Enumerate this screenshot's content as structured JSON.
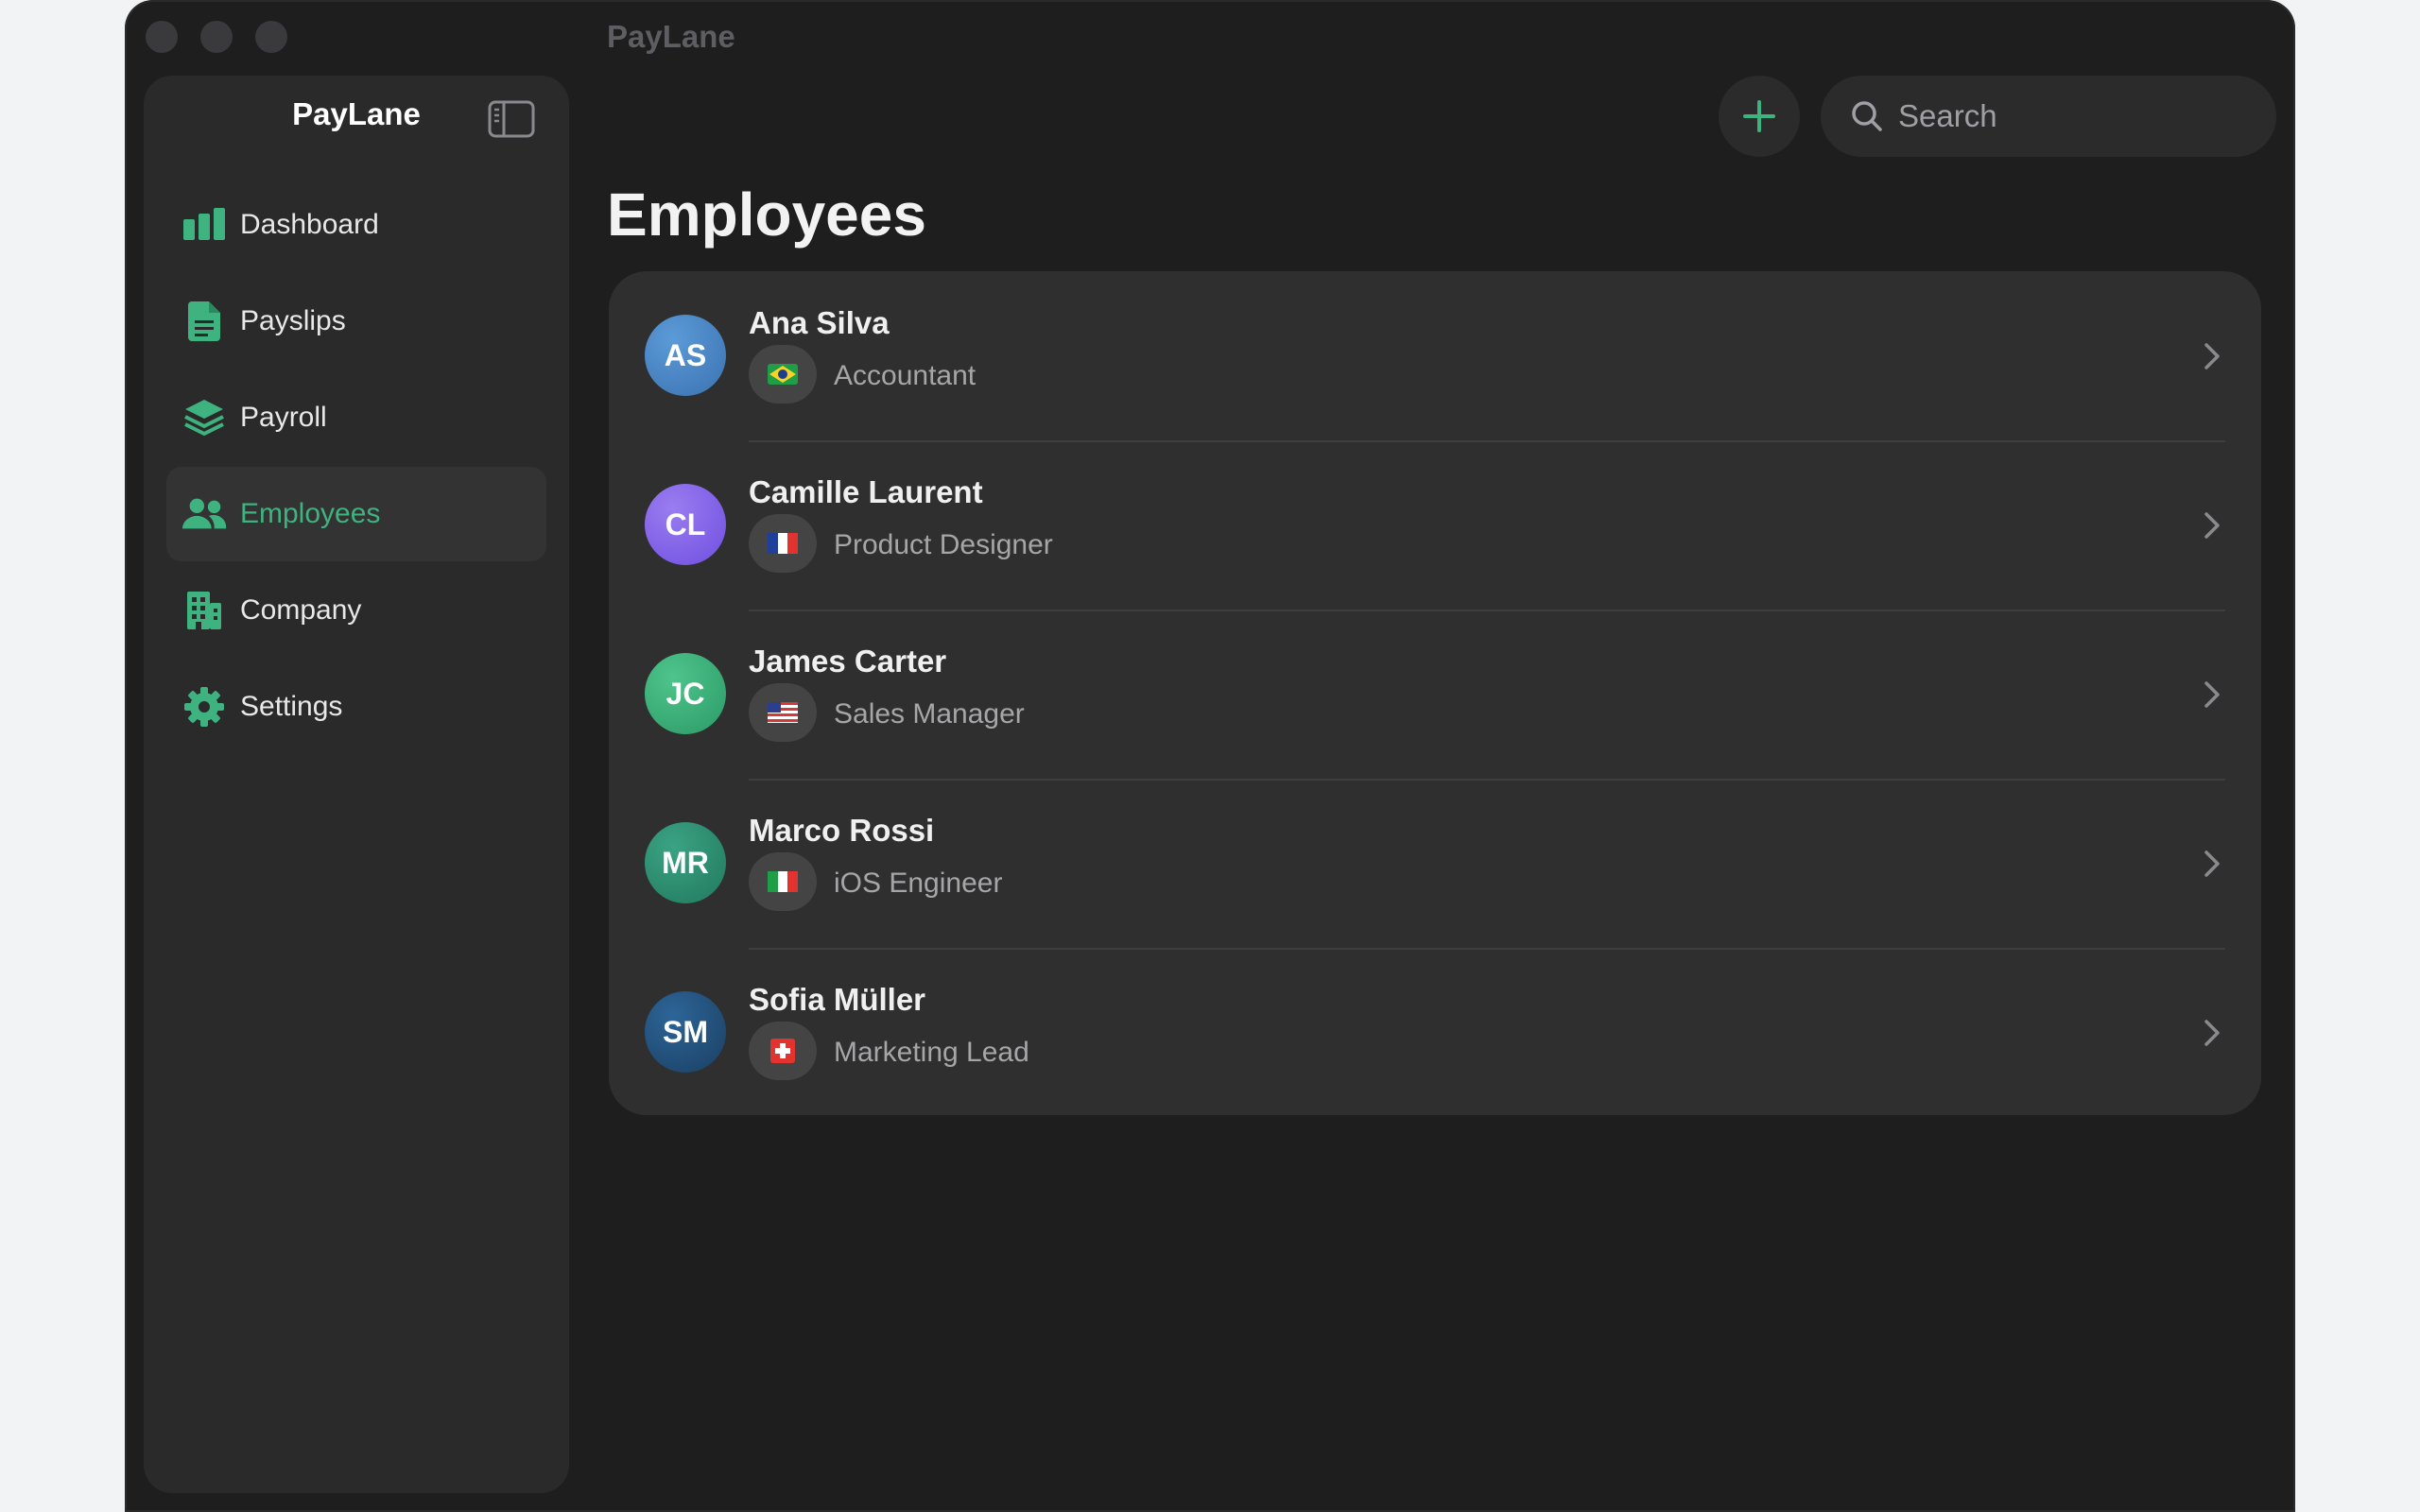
{
  "window": {
    "title": "PayLane"
  },
  "sidebar": {
    "app_name": "PayLane",
    "items": [
      {
        "label": "Dashboard",
        "icon": "bar-chart-icon",
        "active": false
      },
      {
        "label": "Payslips",
        "icon": "document-icon",
        "active": false
      },
      {
        "label": "Payroll",
        "icon": "layers-icon",
        "active": false
      },
      {
        "label": "Employees",
        "icon": "people-icon",
        "active": true
      },
      {
        "label": "Company",
        "icon": "building-icon",
        "active": false
      },
      {
        "label": "Settings",
        "icon": "gear-icon",
        "active": false
      }
    ]
  },
  "toolbar": {
    "add_icon": "plus-icon",
    "search_placeholder": "Search"
  },
  "main": {
    "title": "Employees",
    "employees": [
      {
        "initials": "AS",
        "name": "Ana Silva",
        "role": "Accountant",
        "flag": "brazil-flag-icon",
        "avatar_color": "#4a86c8"
      },
      {
        "initials": "CL",
        "name": "Camille Laurent",
        "role": "Product Designer",
        "flag": "france-flag-icon",
        "avatar_color": "#7c5ce6"
      },
      {
        "initials": "JC",
        "name": "James Carter",
        "role": "Sales Manager",
        "flag": "usa-flag-icon",
        "avatar_color": "#33a872"
      },
      {
        "initials": "MR",
        "name": "Marco Rossi",
        "role": "iOS Engineer",
        "flag": "italy-flag-icon",
        "avatar_color": "#2a8a6c"
      },
      {
        "initials": "SM",
        "name": "Sofia Müller",
        "role": "Marketing Lead",
        "flag": "switzerland-flag-icon",
        "avatar_color": "#1f4f7a"
      }
    ]
  },
  "colors": {
    "accent": "#3fb37f",
    "background": "#1e1e1e",
    "sidebar": "#2a2a2a",
    "card": "#2f2f2f"
  }
}
